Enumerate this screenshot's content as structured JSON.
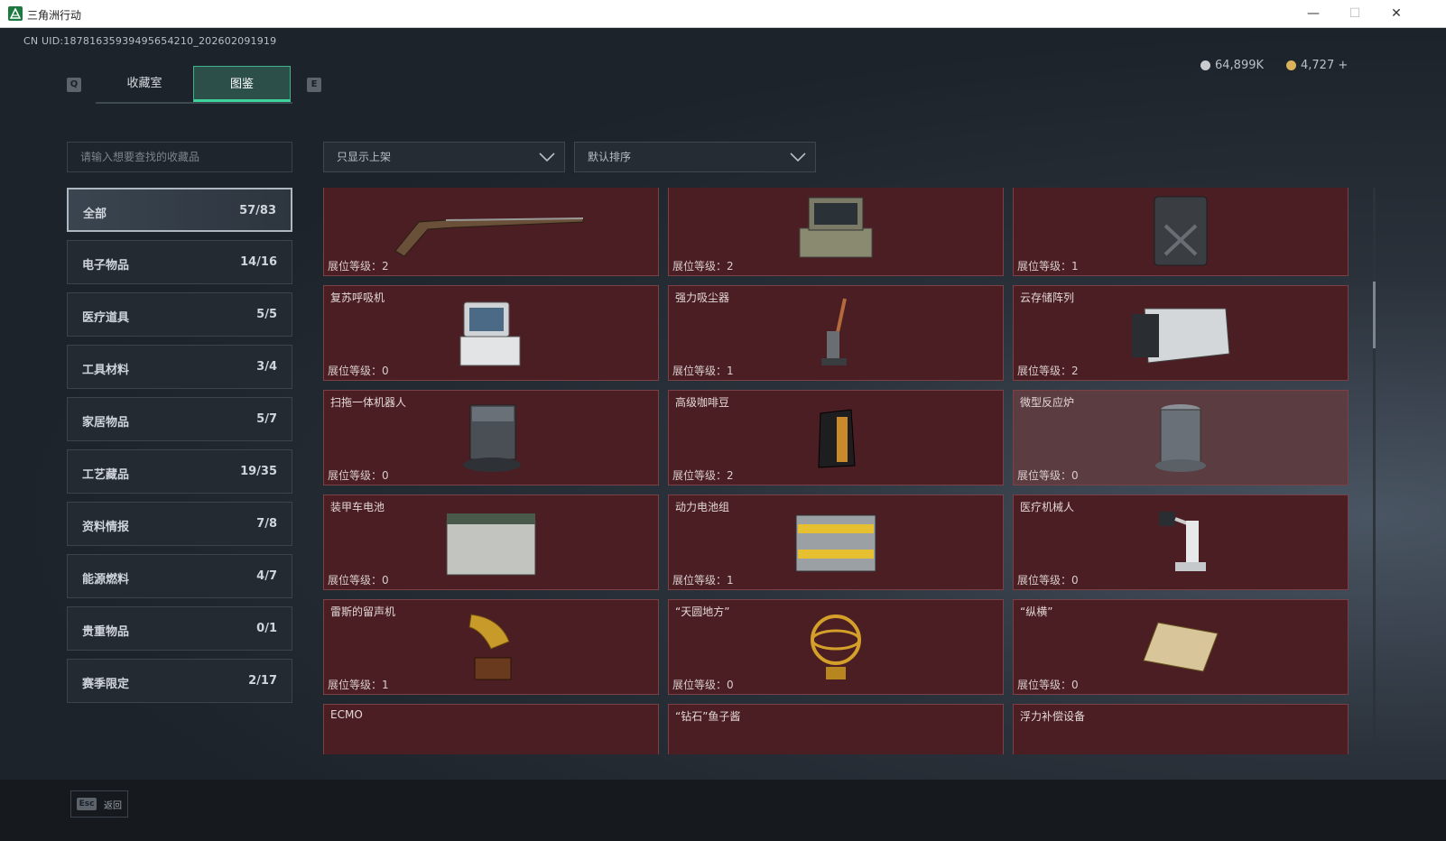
{
  "window": {
    "title": "三角洲行动",
    "minimize": "—",
    "maximize": "☐",
    "close": "✕"
  },
  "uid": "CN UID:18781635939495654210_202602091919",
  "currency": [
    {
      "value": "64,899K",
      "color": "#c8ccd0"
    },
    {
      "value": "4,727 +",
      "color": "#d9b25a"
    }
  ],
  "keys": {
    "left": "Q",
    "right": "E"
  },
  "tabs": [
    {
      "label": "收藏室"
    },
    {
      "label": "图鉴"
    }
  ],
  "search": {
    "placeholder": "请输入想要查找的收藏品"
  },
  "filters": {
    "display": "只显示上架",
    "sort": "默认排序"
  },
  "categories": [
    {
      "label": "全部",
      "count": "57/83"
    },
    {
      "label": "电子物品",
      "count": "14/16"
    },
    {
      "label": "医疗道具",
      "count": "5/5"
    },
    {
      "label": "工具材料",
      "count": "3/4"
    },
    {
      "label": "家居物品",
      "count": "5/7"
    },
    {
      "label": "工艺藏品",
      "count": "19/35"
    },
    {
      "label": "资料情报",
      "count": "7/8"
    },
    {
      "label": "能源燃料",
      "count": "4/7"
    },
    {
      "label": "贵重物品",
      "count": "0/1"
    },
    {
      "label": "赛季限定",
      "count": "2/17"
    }
  ],
  "items": [
    {
      "name": "",
      "level": "展位等级：2",
      "icon": "musket-icon"
    },
    {
      "name": "",
      "level": "展位等级：2",
      "icon": "rugged-terminal-icon"
    },
    {
      "name": "",
      "level": "展位等级：1",
      "icon": "jerrycan-icon"
    },
    {
      "name": "复苏呼吸机",
      "level": "展位等级：0",
      "icon": "ventilator-icon"
    },
    {
      "name": "强力吸尘器",
      "level": "展位等级：1",
      "icon": "vacuum-icon"
    },
    {
      "name": "云存储阵列",
      "level": "展位等级：2",
      "icon": "storage-array-icon"
    },
    {
      "name": "扫拖一体机器人",
      "level": "展位等级：0",
      "icon": "robot-mop-icon"
    },
    {
      "name": "高级咖啡豆",
      "level": "展位等级：2",
      "icon": "coffee-bag-icon"
    },
    {
      "name": "微型反应炉",
      "level": "展位等级：0",
      "icon": "reactor-icon"
    },
    {
      "name": "装甲车电池",
      "level": "展位等级：0",
      "icon": "battery-icon"
    },
    {
      "name": "动力电池组",
      "level": "展位等级：1",
      "icon": "battery-pack-icon"
    },
    {
      "name": "医疗机械人",
      "level": "展位等级：0",
      "icon": "medical-robot-icon"
    },
    {
      "name": "雷斯的留声机",
      "level": "展位等级：1",
      "icon": "gramophone-icon"
    },
    {
      "name": "“天圆地方”",
      "level": "展位等级：0",
      "icon": "armillary-icon"
    },
    {
      "name": "“纵横”",
      "level": "展位等级：0",
      "icon": "chessboard-icon"
    },
    {
      "name": "ECMO",
      "level": "",
      "icon": "ecmo-icon"
    },
    {
      "name": "“钻石”鱼子酱",
      "level": "",
      "icon": "caviar-tin-icon"
    },
    {
      "name": "浮力补偿设备",
      "level": "",
      "icon": "bcd-icon"
    }
  ],
  "bottom": {
    "key": "Esc",
    "label": "返回"
  }
}
